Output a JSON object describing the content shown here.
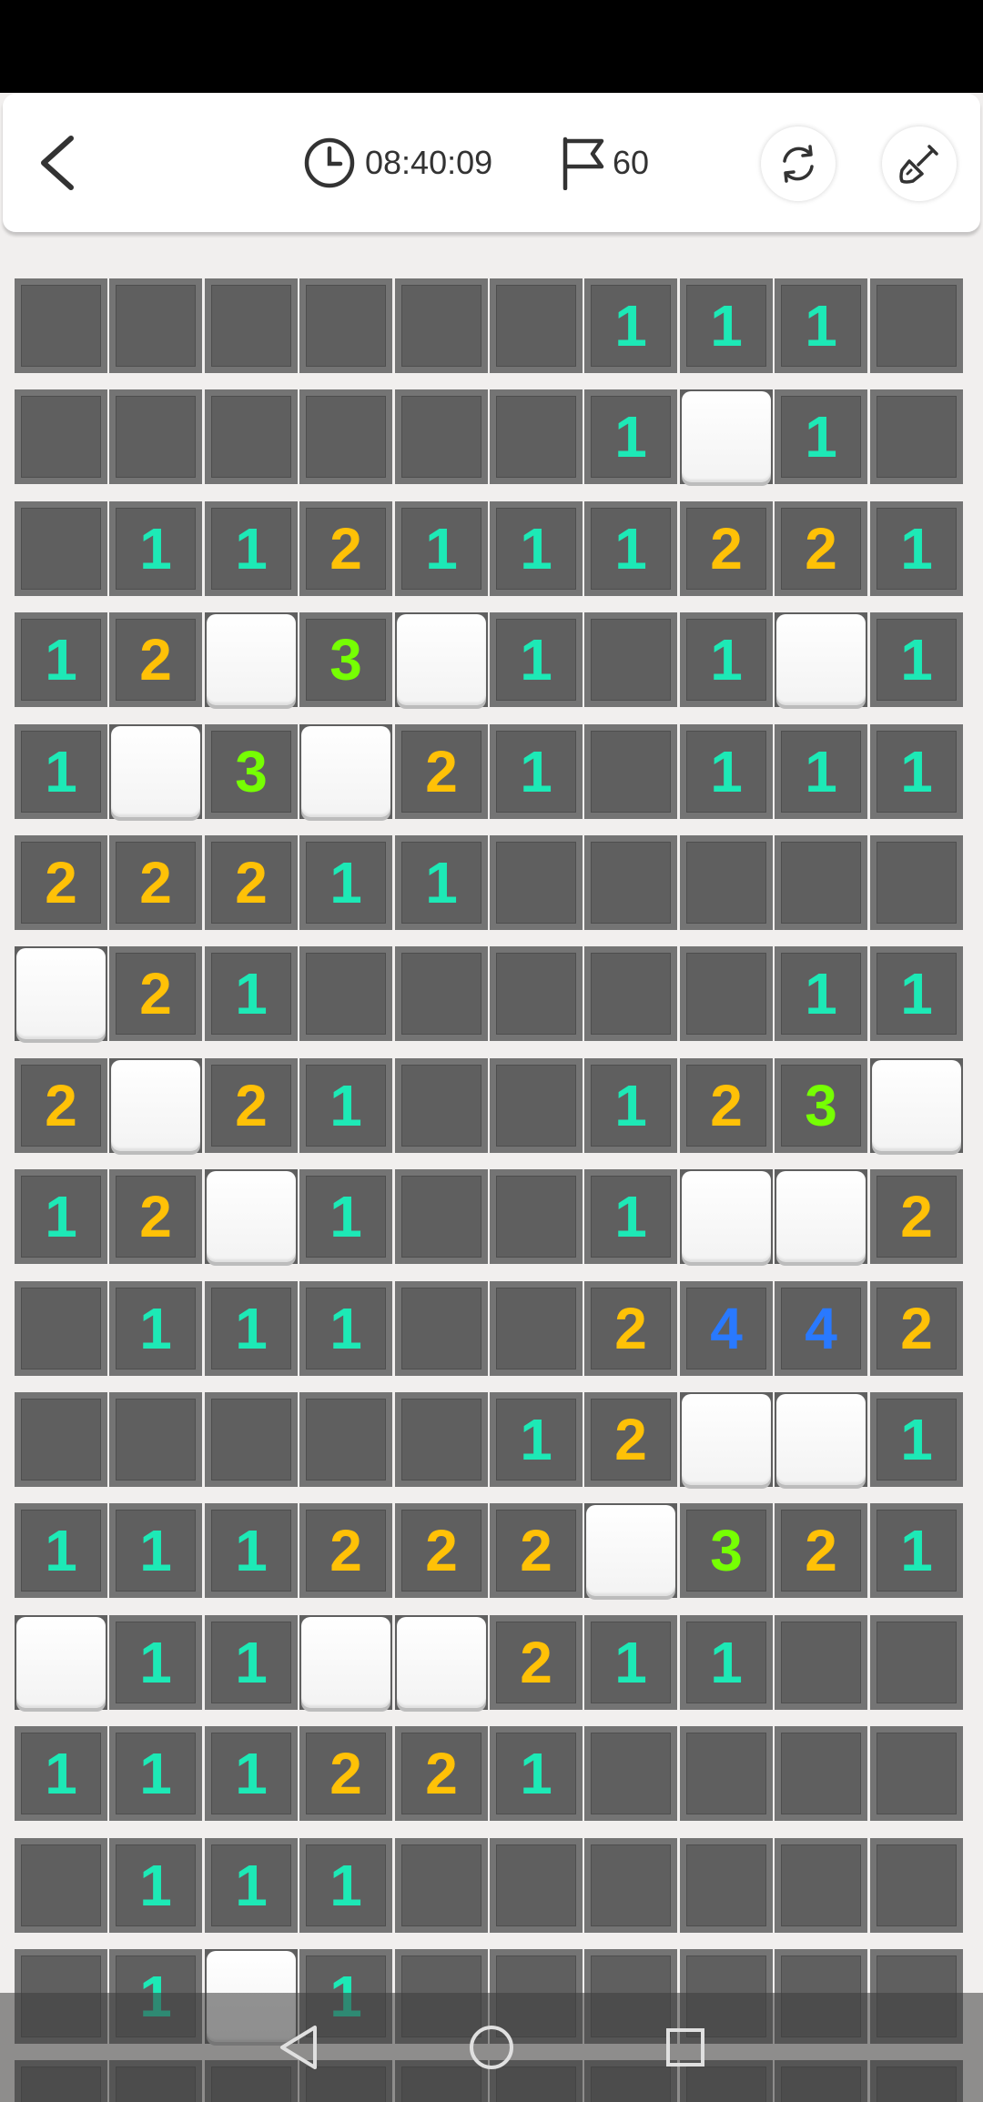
{
  "header": {
    "timer": "08:40:09",
    "flags": "60",
    "icons": {
      "back": "chevron-left-icon",
      "clock": "clock-icon",
      "flag": "flag-icon",
      "refresh": "refresh-icon",
      "shovel": "shovel-icon"
    }
  },
  "board": {
    "legend": "H = hidden tile, O = opened empty tile, digit = opened tile with adjacent mine count",
    "rows": [
      [
        "H",
        "H",
        "H",
        "H",
        "H",
        "H",
        "1",
        "1",
        "1",
        "H"
      ],
      [
        "H",
        "H",
        "H",
        "H",
        "H",
        "H",
        "1",
        "O",
        "1",
        "H"
      ],
      [
        "H",
        "1",
        "1",
        "2",
        "1",
        "1",
        "1",
        "2",
        "2",
        "1"
      ],
      [
        "1",
        "2",
        "O",
        "3",
        "O",
        "1",
        "H",
        "1",
        "O",
        "1"
      ],
      [
        "1",
        "O",
        "3",
        "O",
        "2",
        "1",
        "H",
        "1",
        "1",
        "1"
      ],
      [
        "2",
        "2",
        "2",
        "1",
        "1",
        "H",
        "H",
        "H",
        "H",
        "H"
      ],
      [
        "O",
        "2",
        "1",
        "H",
        "H",
        "H",
        "H",
        "H",
        "1",
        "1"
      ],
      [
        "2",
        "O",
        "2",
        "1",
        "H",
        "H",
        "1",
        "2",
        "3",
        "O"
      ],
      [
        "1",
        "2",
        "O",
        "1",
        "H",
        "H",
        "1",
        "O",
        "O",
        "2"
      ],
      [
        "H",
        "1",
        "1",
        "1",
        "H",
        "H",
        "2",
        "4",
        "4",
        "2"
      ],
      [
        "H",
        "H",
        "H",
        "H",
        "H",
        "1",
        "2",
        "O",
        "O",
        "1"
      ],
      [
        "1",
        "1",
        "1",
        "2",
        "2",
        "2",
        "O",
        "3",
        "2",
        "1"
      ],
      [
        "O",
        "1",
        "1",
        "O",
        "O",
        "2",
        "1",
        "1",
        "H",
        "H"
      ],
      [
        "1",
        "1",
        "1",
        "2",
        "2",
        "1",
        "H",
        "H",
        "H",
        "H"
      ],
      [
        "H",
        "1",
        "1",
        "1",
        "H",
        "H",
        "H",
        "H",
        "H",
        "H"
      ],
      [
        "H",
        "1",
        "O",
        "1",
        "H",
        "H",
        "H",
        "H",
        "H",
        "H"
      ],
      [
        "H",
        "H",
        "H",
        "H",
        "H",
        "H",
        "H",
        "H",
        "H",
        "H"
      ]
    ],
    "number_colors": {
      "1": "#1de9b6",
      "2": "#ffc107",
      "3": "#76ff03",
      "4": "#2979ff"
    },
    "tile_colors": {
      "hidden": "#5f5f5f",
      "border": "#747474",
      "open": "#ffffff"
    }
  },
  "nav": {
    "icons": [
      "back-triangle-icon",
      "home-circle-icon",
      "recents-square-icon"
    ]
  }
}
